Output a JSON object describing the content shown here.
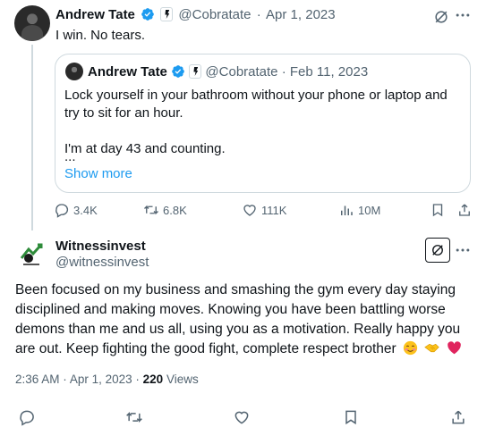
{
  "tweet": {
    "author_name": "Andrew Tate",
    "handle": "@Cobratate",
    "separator": "·",
    "date": "Apr 1, 2023",
    "text": "I win. No tears."
  },
  "quoted_tweet": {
    "author_name": "Andrew Tate",
    "handle": "@Cobratate",
    "separator": "·",
    "date": "Feb 11, 2023",
    "text_p1": "Lock yourself in your bathroom without your phone or laptop and try to sit for an hour.",
    "text_p2": "I'm at day 43 and counting.",
    "ellipsis": "...",
    "show_more": "Show more"
  },
  "tweet_stats": {
    "replies": "3.4K",
    "reposts": "6.8K",
    "likes": "111K",
    "views": "10M"
  },
  "reply": {
    "author_name": "Witnessinvest",
    "handle": "@witnessinvest",
    "text": "Been focused on my business and smashing the gym every day staying disciplined and making moves. Knowing you have been battling worse demons than me and us all, using you as a motivation. Really happy you are out. Keep fighting the good fight, complete respect brother",
    "time": "2:36 AM",
    "separator1": "·",
    "date": "Apr 1, 2023",
    "separator2": "·",
    "view_count": "220",
    "views_label": "Views"
  },
  "colors": {
    "text": "#0f1419",
    "muted": "#536471",
    "link": "#1d9bf0",
    "border": "#cfd9de",
    "verified": "#1d9bf0",
    "heart": "#e0245e"
  },
  "icons": [
    "verified-badge-icon",
    "affiliate-badge-icon",
    "grok-icon",
    "more-icon",
    "reply-icon",
    "repost-icon",
    "like-icon",
    "views-icon",
    "bookmark-icon",
    "share-icon",
    "smiling-face-emoji",
    "handshake-emoji",
    "red-heart-emoji"
  ]
}
